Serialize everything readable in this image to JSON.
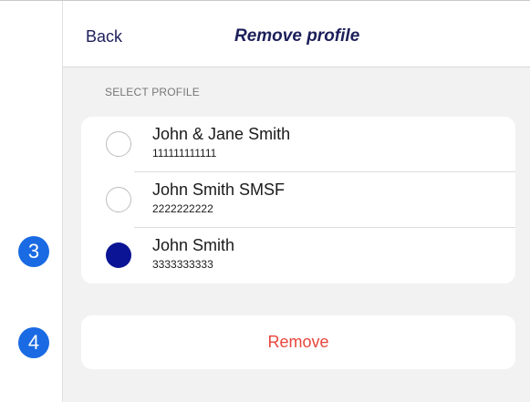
{
  "header": {
    "back_label": "Back",
    "title": "Remove profile"
  },
  "section_label": "SELECT PROFILE",
  "profiles": [
    {
      "name": "John & Jane Smith",
      "number": "111111111111",
      "selected": false
    },
    {
      "name": "John Smith SMSF",
      "number": "2222222222",
      "selected": false
    },
    {
      "name": "John Smith",
      "number": "3333333333",
      "selected": true
    }
  ],
  "remove_label": "Remove",
  "step_badges": [
    "3",
    "4"
  ],
  "colors": {
    "header_text": "#1c1f5a",
    "selected_radio": "#0a1494",
    "remove_text": "#e8453c",
    "badge": "#1a6be3",
    "background": "#f2f2f2"
  }
}
